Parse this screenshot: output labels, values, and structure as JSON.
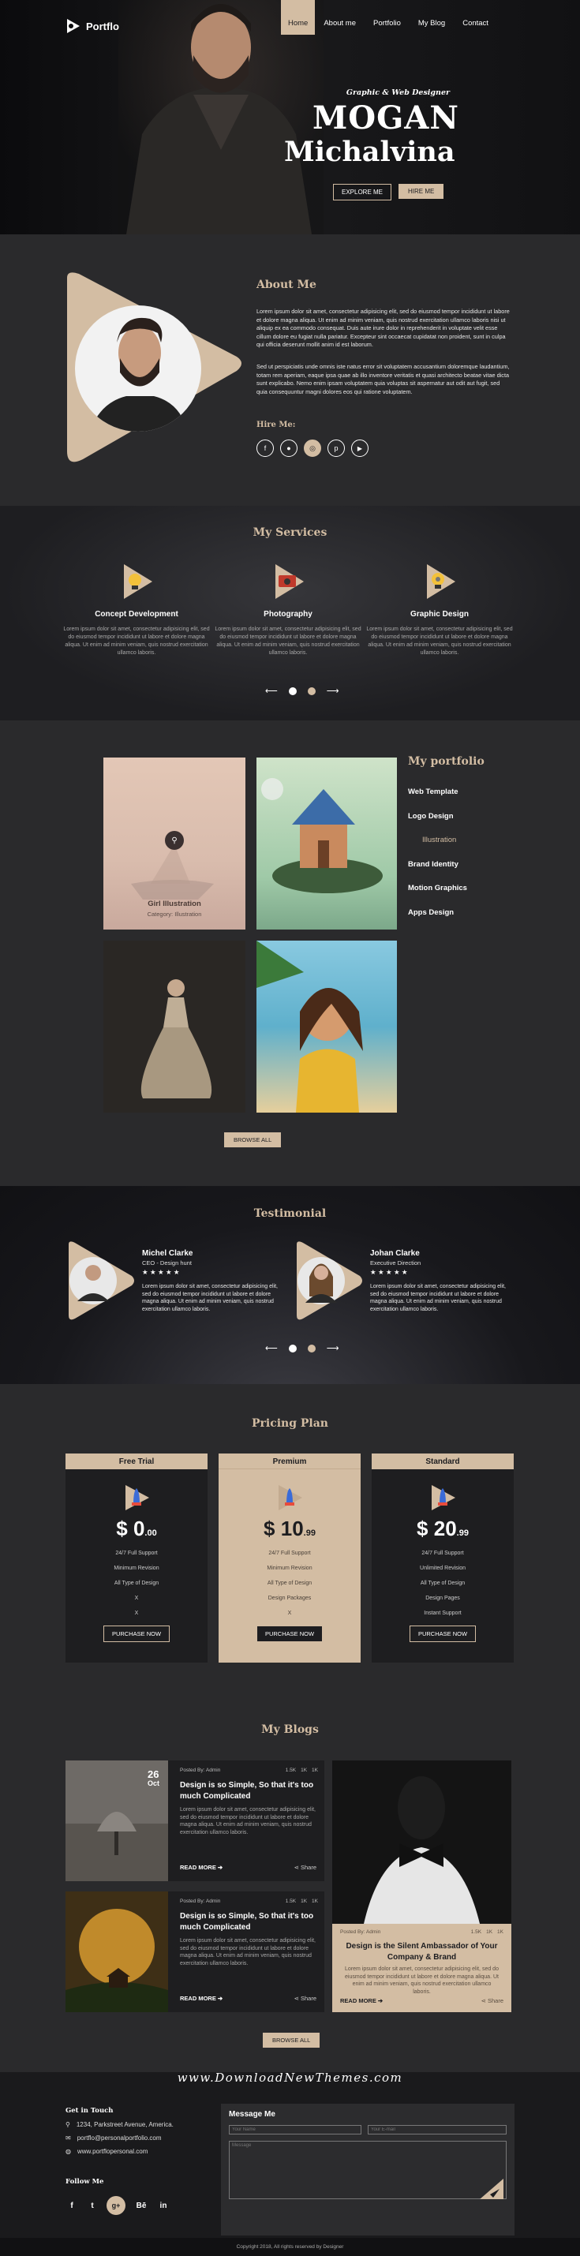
{
  "brand": {
    "name": "Portflo"
  },
  "nav": {
    "items": [
      "Home",
      "About me",
      "Portfolio",
      "My Blog",
      "Contact"
    ]
  },
  "hero": {
    "tagline": "Graphic & Web Designer",
    "name1": "MOGAN",
    "name2": "Michalvina",
    "btn_explore": "EXPLORE ME",
    "btn_hire": "HIRE ME"
  },
  "about": {
    "title": "About Me",
    "p1": "Lorem ipsum dolor sit amet, consectetur adipisicing elit, sed do eiusmod tempor incididunt ut labore et dolore magna aliqua. Ut enim ad minim veniam, quis nostrud exercitation ullamco laboris nisi ut aliquip ex ea commodo consequat. Duis aute irure dolor in reprehenderit in voluptate velit esse cillum dolore eu fugiat nulla pariatur. Excepteur sint occaecat cupidatat non proident, sunt in culpa qui officia deserunt mollit anim id est laborum.",
    "p2": "Sed ut perspiciatis unde omnis iste natus error sit voluptatem accusantium doloremque laudantium, totam rem aperiam, eaque ipsa quae ab illo inventore veritatis et quasi architecto beatae vitae dicta sunt explicabo. Nemo enim ipsam voluptatem quia voluptas sit aspernatur aut odit aut fugit, sed quia consequuntur magni dolores eos qui ratione voluptatem.",
    "hire_title": "Hire Me:",
    "social_icons": [
      "freelancer-icon",
      "upwork-icon",
      "dribbble-icon",
      "pinterest-icon",
      "youtube-icon"
    ]
  },
  "services": {
    "title": "My Services",
    "items": [
      {
        "title": "Concept Development",
        "icon": "lightbulb-icon",
        "text": "Lorem ipsum dolor sit amet, consectetur adipisicing elit, sed do eiusmod tempor incididunt ut labore et dolore magna aliqua. Ut enim ad minim veniam, quis nostrud exercitation ullamco laboris."
      },
      {
        "title": "Photography",
        "icon": "camera-icon",
        "text": "Lorem ipsum dolor sit amet, consectetur adipisicing elit, sed do eiusmod tempor incididunt ut labore et dolore magna aliqua. Ut enim ad minim veniam, quis nostrud exercitation ullamco laboris."
      },
      {
        "title": "Graphic Design",
        "icon": "lightbulb-gear-icon",
        "text": "Lorem ipsum dolor sit amet, consectetur adipisicing elit, sed do eiusmod tempor incididunt ut labore et dolore magna aliqua. Ut enim ad minim veniam, quis nostrud exercitation ullamco laboris."
      }
    ]
  },
  "portfolio": {
    "title": "My portfolio",
    "filters": [
      "Web Template",
      "Logo Design",
      "Illustration",
      "Brand Identity",
      "Motion Graphics",
      "Apps Design"
    ],
    "featured": {
      "title": "Girl Illustration",
      "category": "Category: Illustration"
    },
    "browse": "BROWSE ALL"
  },
  "testimonial": {
    "title": "Testimonial",
    "items": [
      {
        "name": "Michel Clarke",
        "role": "CEO - Design hunt",
        "stars": "★ ★ ★ ★ ★",
        "text": "Lorem ipsum dolor sit amet, consectetur adipisicing elit, sed do eiusmod tempor incididunt ut labore et dolore magna aliqua. Ut enim ad minim veniam, quis nostrud exercitation ullamco laboris."
      },
      {
        "name": "Johan Clarke",
        "role": "Executive Direction",
        "stars": "★ ★ ★ ★ ★",
        "text": "Lorem ipsum dolor sit amet, consectetur adipisicing elit, sed do eiusmod tempor incididunt ut labore et dolore magna aliqua. Ut enim ad minim veniam, quis nostrud exercitation ullamco laboris."
      }
    ]
  },
  "pricing": {
    "title": "Pricing Plan",
    "plans": [
      {
        "name": "Free Trial",
        "dollars": "$ 0",
        "cents": ".00",
        "features": [
          "24/7 Full Support",
          "Minimum Revision",
          "All Type of Design",
          "X",
          "X"
        ],
        "button": "PURCHASE NOW"
      },
      {
        "name": "Premium",
        "dollars": "$ 10",
        "cents": ".99",
        "features": [
          "24/7 Full Support",
          "Minimum Revision",
          "All Type of Design",
          "Design Packages",
          "X"
        ],
        "button": "PURCHASE NOW"
      },
      {
        "name": "Standard",
        "dollars": "$ 20",
        "cents": ".99",
        "features": [
          "24/7 Full Support",
          "Unlimited Revision",
          "All Type of Design",
          "Design Pages",
          "Instant Support"
        ],
        "button": "PURCHASE NOW"
      }
    ]
  },
  "blogs": {
    "title": "My Blogs",
    "posted": "Posted By: Admin",
    "likes": "1.5K",
    "comments": "1K",
    "shares": "1K",
    "read_more": "READ MORE",
    "share": "Share",
    "date_day": "26",
    "date_month": "Oct",
    "post1_title": "Design is so Simple, So that it's too much Complicated",
    "post2_title": "Design is so Simple, So that it's too much Complicated",
    "post3_title": "Design is the Silent Ambassador of Your Company & Brand",
    "excerpt": "Lorem ipsum dolor sit amet, consectetur adipisicing elit, sed do eiusmod tempor incididunt ut labore et dolore magna aliqua. Ut enim ad minim veniam, quis nostrud exercitation ullamco laboris.",
    "browse": "BROWSE ALL"
  },
  "watermark": "www.DownloadNewThemes.com",
  "contact": {
    "title": "Get in Touch",
    "address": "1234, Parkstreet Avenue, America.",
    "email": "portflo@personalportfolio.com",
    "website": "www.portflopersonal.com",
    "follow": "Follow Me",
    "social": [
      "f",
      "t",
      "g+",
      "Bē",
      "in"
    ],
    "message_title": "Message Me",
    "ph_name": "Your Name",
    "ph_email": "Your E-mail",
    "ph_message": "Message"
  },
  "footer": {
    "copyright": "Copyright 2018, All rights reserved by Designer"
  }
}
